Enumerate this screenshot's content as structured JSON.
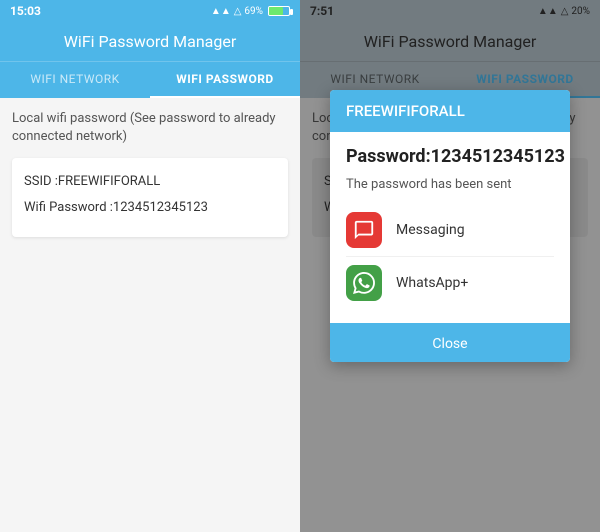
{
  "left": {
    "statusBar": {
      "time": "15:03",
      "icons": "▲▲▼",
      "battery": "69%"
    },
    "header": "WiFi Password Manager",
    "tabs": [
      {
        "label": "WIFI NETWORK",
        "active": false
      },
      {
        "label": "WIFI PASSWORD",
        "active": true
      }
    ],
    "description": "Local wifi password (See password to already connected network)",
    "ssid": "SSID :FREEWIFIFORALL",
    "wifiPassword": "Wifi Password :1234512345123"
  },
  "right": {
    "statusBar": {
      "time": "7:51",
      "icons": "▲▲▼",
      "battery": "20%"
    },
    "header": "WiFi Password Manager",
    "tabs": [
      {
        "label": "WIFI NETWORK",
        "active": false
      },
      {
        "label": "WIFI PASSWORD",
        "active": true
      }
    ],
    "description": "Local wifi password (See password to already connected network)",
    "ssid": "SSID :FREEWIFIFORALL",
    "wifiPasswordPartial": "Wifi P...",
    "dialog": {
      "title": "FREEWIFIFORALL",
      "password": "Password:1234512345123",
      "sentText": "The password has been sent",
      "shareOptions": [
        {
          "icon": "messaging",
          "label": "Messaging"
        },
        {
          "icon": "whatsapp",
          "label": "WhatsApp+"
        }
      ],
      "closeButton": "Close"
    }
  }
}
